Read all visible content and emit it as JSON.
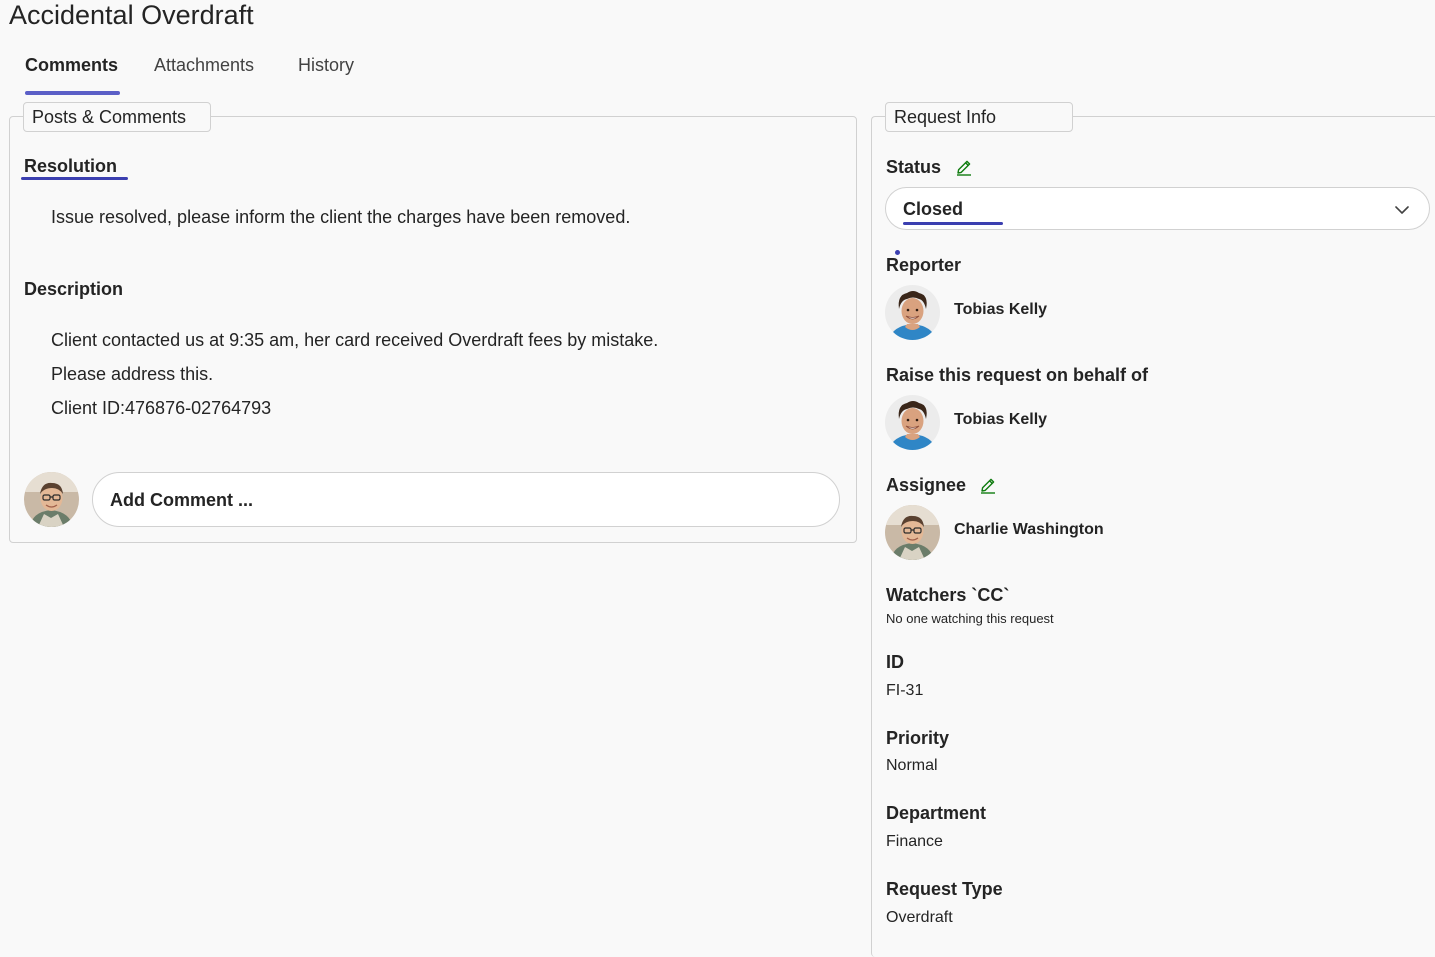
{
  "page": {
    "title": "Accidental Overdraft"
  },
  "tabs": [
    {
      "label": "Comments",
      "active": true
    },
    {
      "label": "Attachments",
      "active": false
    },
    {
      "label": "History",
      "active": false
    }
  ],
  "posts": {
    "legend": "Posts & Comments",
    "resolution": {
      "heading": "Resolution",
      "text": "Issue resolved, please inform the client the charges have been removed."
    },
    "description": {
      "heading": "Description",
      "lines": [
        "Client contacted us at 9:35 am, her card received Overdraft fees by mistake.",
        "Please address this.",
        "Client ID:476876-02764793"
      ]
    },
    "add_comment_placeholder": "Add Comment ..."
  },
  "request_info": {
    "legend": "Request Info",
    "status": {
      "label": "Status",
      "value": "Closed"
    },
    "reporter": {
      "label": "Reporter",
      "name": "Tobias Kelly"
    },
    "on_behalf": {
      "label": "Raise this request on behalf of",
      "name": "Tobias Kelly"
    },
    "assignee": {
      "label": "Assignee",
      "name": "Charlie Washington"
    },
    "watchers": {
      "label": "Watchers `CC`",
      "value": "No one watching this request"
    },
    "id": {
      "label": "ID",
      "value": "FI-31"
    },
    "priority": {
      "label": "Priority",
      "value": "Normal"
    },
    "department": {
      "label": "Department",
      "value": "Finance"
    },
    "request_type": {
      "label": "Request Type",
      "value": "Overdraft"
    }
  },
  "colors": {
    "accent": "#5b5fc7",
    "underline": "#3b3fb0",
    "edit_icon": "#107c10",
    "border": "#d1d1d1"
  },
  "icons": {
    "edit": "pencil-icon",
    "dropdown": "chevron-down-icon"
  }
}
